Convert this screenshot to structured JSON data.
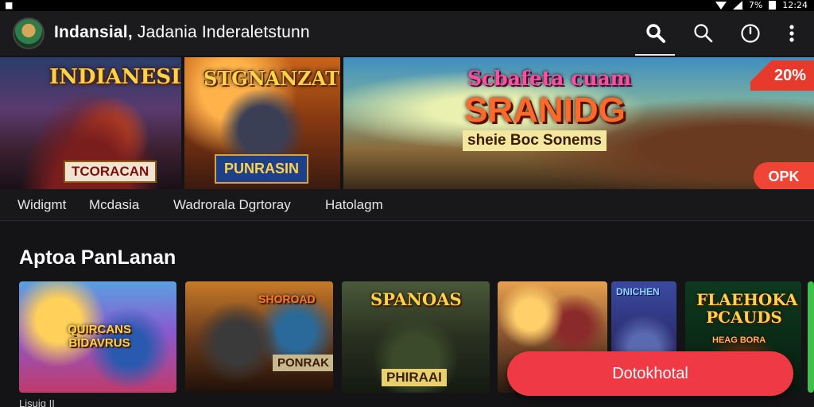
{
  "status_bar": {
    "left_glyph": "■",
    "time": "12:24",
    "battery_text": "7%",
    "icons": [
      "wifi-icon",
      "signal-icon",
      "battery-icon"
    ]
  },
  "app_bar": {
    "title_bold": "Indansial,",
    "title_rest": "Jadania Inderaletstunn",
    "avatar_icon": "game-avatar-icon",
    "actions": [
      "search-icon",
      "search-icon",
      "timer-icon",
      "more-vert-icon"
    ]
  },
  "carousel": {
    "banners": [
      {
        "title": "INDIANESIA",
        "subtitle": "TCORACAN"
      },
      {
        "title": "STGNANZAT",
        "subtitle": "PUNRASIN"
      },
      {
        "title_top": "Scbafeta cuam",
        "title_main": "SRANIDG",
        "subtitle": "sheie Boc Sonems"
      }
    ],
    "promo_badge": "20%",
    "promo_button": "OPK"
  },
  "tabs": [
    "Widigmt",
    "Mcdasia",
    "Wadrorala Dgrtoray",
    "Hatolagm"
  ],
  "section": {
    "title": "Aptoa PanLanan"
  },
  "cards": [
    {
      "title": "QUIRCANS BIDAVRUS"
    },
    {
      "title": "SHOROAD",
      "subtitle": "PONRAK"
    },
    {
      "title": "SPANOAS",
      "subtitle": "PHIRAAI"
    },
    {
      "title": ""
    },
    {
      "title": "DNICHEN"
    },
    {
      "title": "FLAEHOKA PCAUDS",
      "subtitle": "HEAG BORA"
    }
  ],
  "fab": {
    "label": "Dotokhotal"
  },
  "bottom_label": "Lisuig II"
}
